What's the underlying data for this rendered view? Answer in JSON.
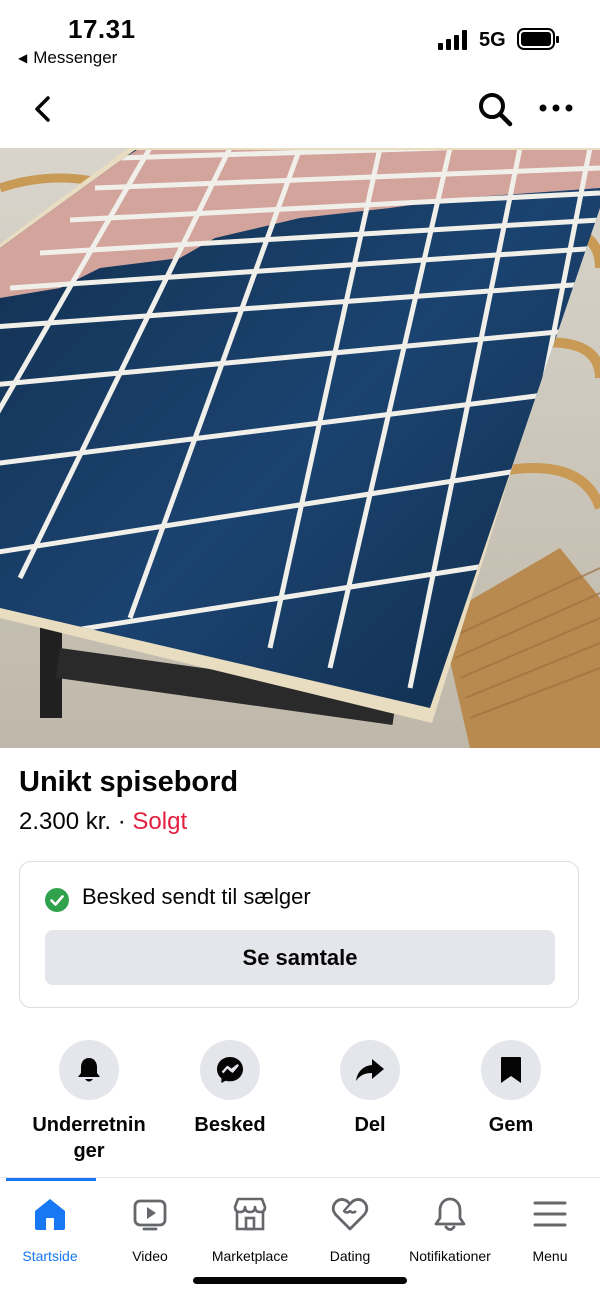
{
  "status": {
    "time": "17.31",
    "back_app": "Messenger",
    "network": "5G"
  },
  "listing": {
    "title": "Unikt spisebord",
    "price": "2.300 kr.",
    "separator": "·",
    "status": "Solgt"
  },
  "message": {
    "sent_text": "Besked sendt til sælger",
    "button": "Se samtale"
  },
  "actions": [
    {
      "label": "Underretninger",
      "icon": "bell-icon"
    },
    {
      "label": "Besked",
      "icon": "messenger-icon"
    },
    {
      "label": "Del",
      "icon": "share-icon"
    },
    {
      "label": "Gem",
      "icon": "bookmark-icon"
    }
  ],
  "tabs": [
    {
      "label": "Startside",
      "icon": "home-icon",
      "active": true
    },
    {
      "label": "Video",
      "icon": "video-icon"
    },
    {
      "label": "Marketplace",
      "icon": "marketplace-icon"
    },
    {
      "label": "Dating",
      "icon": "dating-icon"
    },
    {
      "label": "Notifikationer",
      "icon": "notifications-icon"
    },
    {
      "label": "Menu",
      "icon": "menu-icon"
    }
  ],
  "photo": {
    "slides": 3,
    "current": 1
  },
  "colors": {
    "accent": "#1877f2",
    "sold": "#e41e3f",
    "check": "#31a24c",
    "button_bg": "#e4e6eb"
  }
}
